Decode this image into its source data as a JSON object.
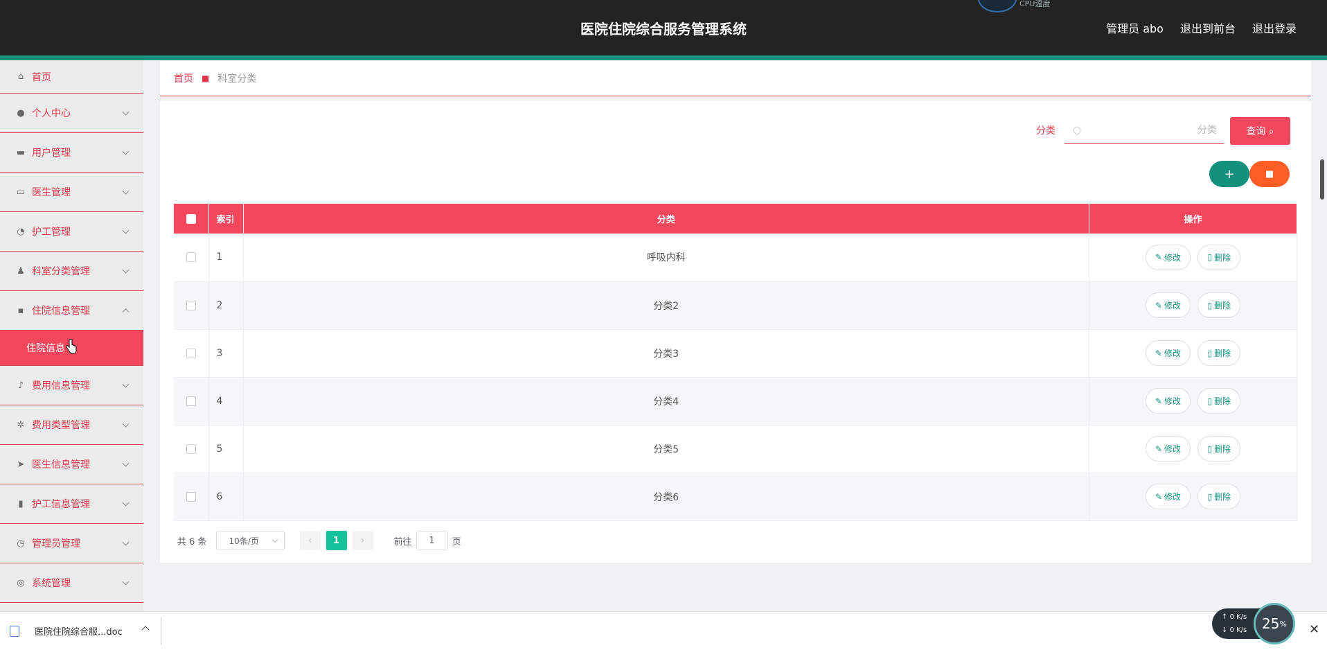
{
  "header": {
    "title": "医院住院综合服务管理系统",
    "user": "管理员 abo",
    "front": "退出到前台",
    "logout": "退出登录",
    "cpu_label": "CPU温度"
  },
  "sidebar": {
    "items": [
      {
        "label": "首页",
        "icon": "home-icon"
      },
      {
        "label": "个人中心",
        "icon": "user-icon"
      },
      {
        "label": "用户管理",
        "icon": "ticket-icon"
      },
      {
        "label": "医生管理",
        "icon": "monitor-icon"
      },
      {
        "label": "护工管理",
        "icon": "gauge-icon"
      },
      {
        "label": "科室分类管理",
        "icon": "person-icon"
      },
      {
        "label": "住院信息管理",
        "icon": "chat-icon"
      },
      {
        "label": "费用信息管理",
        "icon": "mic-icon"
      },
      {
        "label": "费用类型管理",
        "icon": "aperture-icon"
      },
      {
        "label": "医生信息管理",
        "icon": "send-icon"
      },
      {
        "label": "护工信息管理",
        "icon": "bar-chart-icon"
      },
      {
        "label": "管理员管理",
        "icon": "clock-icon"
      },
      {
        "label": "系统管理",
        "icon": "lifebuoy-icon"
      }
    ],
    "sub_item": "住院信息"
  },
  "breadcrumb": {
    "home": "首页",
    "current": "科室分类"
  },
  "search": {
    "label": "分类",
    "placeholder": "分类",
    "button": "查询"
  },
  "actions": {
    "add": "+",
    "delete": "🗑"
  },
  "table": {
    "headers": {
      "index": "索引",
      "category": "分类",
      "operation": "操作"
    },
    "rows": [
      {
        "index": "1",
        "category": "呼吸内科"
      },
      {
        "index": "2",
        "category": "分类2"
      },
      {
        "index": "3",
        "category": "分类3"
      },
      {
        "index": "4",
        "category": "分类4"
      },
      {
        "index": "5",
        "category": "分类5"
      },
      {
        "index": "6",
        "category": "分类6"
      }
    ],
    "edit_label": "修改",
    "delete_label": "删除"
  },
  "pager": {
    "total": "共 6 条",
    "page_size": "10条/页",
    "prev": "‹",
    "current": "1",
    "next": "›",
    "goto_prefix": "前往",
    "goto_value": "1",
    "goto_suffix": "页"
  },
  "download": {
    "filename": "医院住院综合服...doc"
  },
  "network": {
    "up": "0 K/s",
    "down": "0 K/s",
    "cpu_percent": "25",
    "percent_sign": "%"
  }
}
